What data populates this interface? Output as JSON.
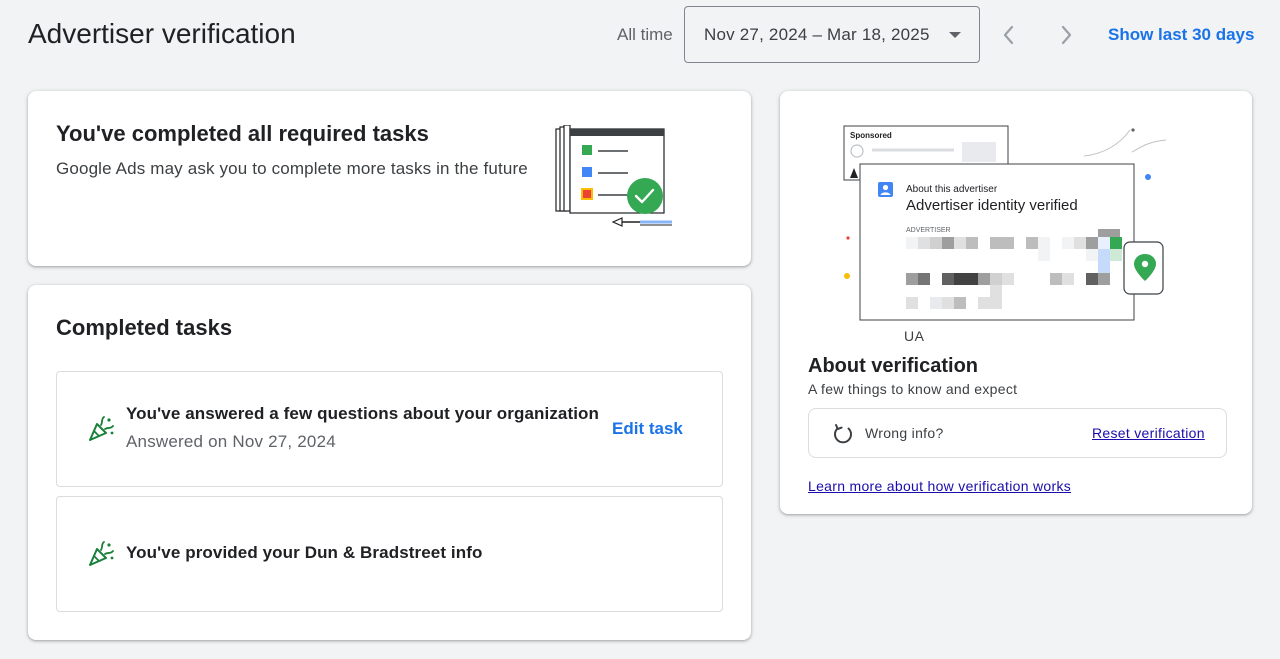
{
  "header": {
    "title": "Advertiser verification",
    "range_label": "All time",
    "date_range": "Nov 27, 2024 – Mar 18, 2025",
    "show_last_label": "Show last 30 days"
  },
  "status_card": {
    "title": "You've completed all required tasks",
    "subtitle": "Google Ads may ask you to complete more tasks in the future"
  },
  "tasks_card": {
    "title": "Completed tasks",
    "tasks": [
      {
        "title": "You've answered a few questions about your organization",
        "meta": "Answered on Nov 27, 2024",
        "action_label": "Edit task"
      },
      {
        "title": "You've provided your Dun & Bradstreet info"
      }
    ]
  },
  "about_card": {
    "illustration": {
      "sponsored_label": "Sponsored",
      "about_label": "About this advertiser",
      "verified_label": "Advertiser identity verified",
      "advertiser_label": "ADVERTISER",
      "region": "UA"
    },
    "title": "About verification",
    "subtitle": "A few things to know and expect",
    "wrong_info_label": "Wrong info?",
    "reset_label": "Reset verification",
    "learn_more_label": "Learn more about how verification works"
  },
  "colors": {
    "accent": "#1a73e8",
    "link": "#1a0dab",
    "success": "#34a853",
    "background": "#f1f3f4"
  },
  "icons": {
    "date_caret": "caret-down-icon",
    "prev": "chevron-left-icon",
    "next": "chevron-right-icon",
    "task": "celebration-icon",
    "reset": "refresh-icon"
  }
}
